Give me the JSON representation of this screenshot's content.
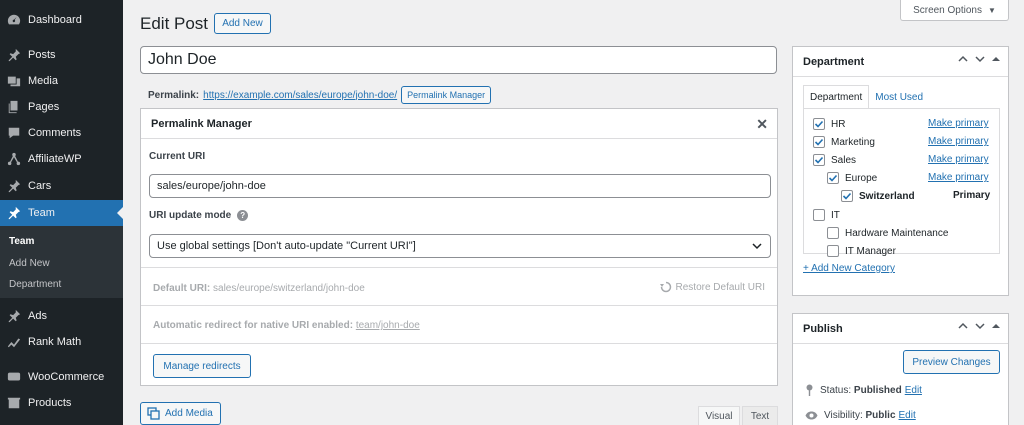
{
  "sidebar": {
    "items": [
      {
        "label": "Dashboard",
        "icon": "dashboard-icon"
      },
      {
        "label": "Posts",
        "icon": "pin-icon"
      },
      {
        "label": "Media",
        "icon": "media-icon"
      },
      {
        "label": "Pages",
        "icon": "pages-icon"
      },
      {
        "label": "Comments",
        "icon": "comments-icon"
      },
      {
        "label": "AffiliateWP",
        "icon": "affiliate-icon"
      },
      {
        "label": "Cars",
        "icon": "pin-icon"
      },
      {
        "label": "Team",
        "icon": "pin-icon"
      },
      {
        "label": "Ads",
        "icon": "pin-icon"
      },
      {
        "label": "Rank Math",
        "icon": "rankmath-icon"
      },
      {
        "label": "WooCommerce",
        "icon": "woo-icon"
      },
      {
        "label": "Products",
        "icon": "products-icon"
      }
    ],
    "submenu": [
      "Team",
      "Add New",
      "Department"
    ]
  },
  "header": {
    "title": "Edit Post",
    "add_new": "Add New",
    "screen_options": "Screen Options"
  },
  "post": {
    "title": "John Doe",
    "permalink_label": "Permalink:",
    "permalink_url": "https://example.com/sales/europe/john-doe/",
    "permalink_button": "Permalink Manager"
  },
  "pm": {
    "title": "Permalink Manager",
    "current_uri_label": "Current URI",
    "current_uri": "sales/europe/john-doe",
    "mode_label": "URI update mode",
    "mode_value": "Use global settings [Don't auto-update \"Current URI\"]",
    "default_uri_label": "Default URI:",
    "default_uri": "sales/europe/switzerland/john-doe",
    "restore": "Restore Default URI",
    "redirect_label": "Automatic redirect for native URI enabled:",
    "redirect_value": "team/john-doe",
    "manage_redirects": "Manage redirects"
  },
  "editor": {
    "add_media": "Add Media",
    "tab_visual": "Visual",
    "tab_text": "Text"
  },
  "department": {
    "title": "Department",
    "tab_all": "Department",
    "tab_used": "Most Used",
    "make_primary": "Make primary",
    "primary": "Primary",
    "categories": [
      {
        "label": "HR",
        "checked": true
      },
      {
        "label": "Marketing",
        "checked": true
      },
      {
        "label": "Sales",
        "checked": true
      },
      {
        "label": "Europe",
        "checked": true
      },
      {
        "label": "Switzerland",
        "checked": true
      },
      {
        "label": "IT",
        "checked": false
      },
      {
        "label": "Hardware Maintenance",
        "checked": false
      },
      {
        "label": "IT Manager",
        "checked": false
      }
    ],
    "add_new": "+ Add New Category"
  },
  "publish": {
    "title": "Publish",
    "preview": "Preview Changes",
    "status_label": "Status:",
    "status_value": "Published",
    "visibility_label": "Visibility:",
    "visibility_value": "Public",
    "edit": "Edit"
  },
  "colors": {
    "admin_bar": "#1d2327",
    "accent": "#2271b1",
    "background": "#f0f0f1"
  }
}
